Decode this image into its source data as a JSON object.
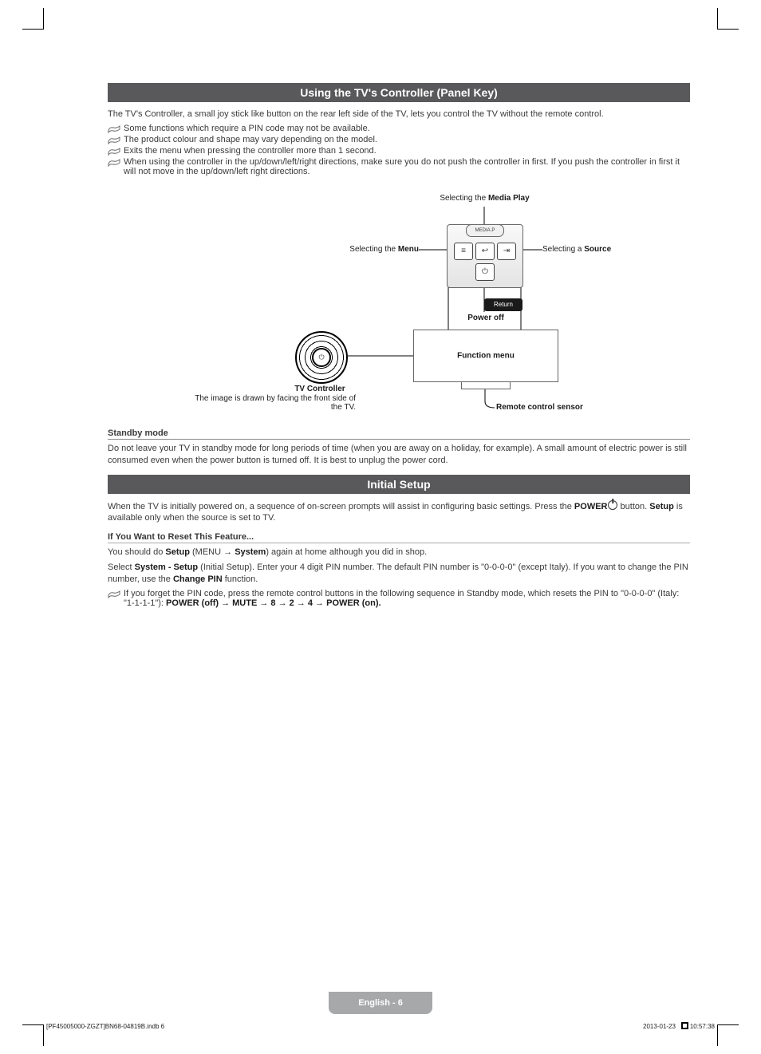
{
  "section1": {
    "title": "Using the TV's Controller (Panel Key)",
    "intro": "The TV's Controller, a small joy stick like button on the rear left side of the TV, lets you control the TV without the remote control.",
    "notes": [
      "Some functions which require a PIN code may not be available.",
      "The product colour and shape may vary depending on the model.",
      "Exits the menu when pressing the controller more than 1 second.",
      "When using the controller in the up/down/left/right directions, make sure you do not push the controller in first. If you push the controller in first it will not move in the up/down/left right directions."
    ],
    "diagram": {
      "media_play_pre": "Selecting the ",
      "media_play_b": "Media Play",
      "menu_pre": "Selecting the ",
      "menu_b": "Menu",
      "source_pre": "Selecting a ",
      "source_b": "Source",
      "return": "Return",
      "power_off": "Power off",
      "function_menu": "Function menu",
      "tv_controller": "TV Controller",
      "caption": "The image is drawn by facing the front side of the TV.",
      "remote_sensor": "Remote control sensor",
      "media_p_label": "MEDIA.P"
    }
  },
  "standby": {
    "heading": "Standby mode",
    "body": "Do not leave your TV in standby mode for long periods of time (when you are away on a holiday, for example). A small amount of electric power is still consumed even when the power button is turned off. It is best to unplug the power cord."
  },
  "section2": {
    "title": "Initial Setup",
    "body_pre": "When the TV is initially powered on, a sequence of on-screen prompts will assist in configuring basic settings. Press the ",
    "power_b": "POWER",
    "body_mid": " button. ",
    "setup_b": "Setup",
    "body_post": " is available only when the source is set to TV.",
    "reset_heading": "If You Want to Reset This Feature...",
    "reset_l1_pre": "You should do ",
    "reset_l1_setup": "Setup",
    "reset_l1_menu": " (MENU → ",
    "reset_l1_system": "System",
    "reset_l1_post": ") again at home although you did in shop.",
    "reset_l2_pre": "Select ",
    "reset_l2_sys_setup": "System - Setup",
    "reset_l2_mid": " (Initial Setup). Enter your 4 digit PIN number. The default PIN number is \"0-0-0-0\" (except Italy). If you want to change the PIN number, use the ",
    "reset_l2_changepin": "Change PIN",
    "reset_l2_post": " function.",
    "reset_note_pre": "If you forget the PIN code, press the remote control buttons in the following sequence in Standby mode, which resets the PIN to \"0-0-0-0\" (Italy: \"1-1-1-1\"): ",
    "reset_note_seq": "POWER (off) → MUTE → 8 → 2 → 4 → POWER (on)."
  },
  "footer": {
    "page_label": "English - 6",
    "left": "[PF45005000-ZGZT]BN68-04819B.indb   6",
    "right": "2013-01-23   ￼ 10:57:38"
  }
}
